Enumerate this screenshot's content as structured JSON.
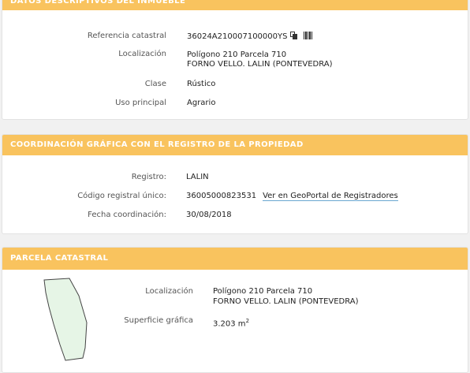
{
  "section1": {
    "title": "DATOS DESCRIPTIVOS DEL INMUEBLE",
    "fields": {
      "referencia_label": "Referencia catastral",
      "referencia_value": "36024A210007100000YS",
      "localizacion_label": "Localización",
      "localizacion_line1": "Polígono 210 Parcela 710",
      "localizacion_line2": "FORNO VELLO. LALIN (PONTEVEDRA)",
      "clase_label": "Clase",
      "clase_value": "Rústico",
      "uso_label": "Uso principal",
      "uso_value": "Agrario"
    },
    "icons": [
      "copy-icon",
      "barcode-icon"
    ]
  },
  "section2": {
    "title": "COORDINACIÓN GRÁFICA CON EL REGISTRO DE LA PROPIEDAD",
    "fields": {
      "registro_label": "Registro:",
      "registro_value": "LALIN",
      "codigo_label": "Código registral único:",
      "codigo_value": "36005000823531",
      "codigo_link": "Ver en GeoPortal de Registradores",
      "fecha_label": "Fecha coordinación:",
      "fecha_value": "30/08/2018"
    }
  },
  "section3": {
    "title": "PARCELA CATASTRAL",
    "fields": {
      "localizacion_label": "Localización",
      "localizacion_line1": "Polígono 210 Parcela 710",
      "localizacion_line2": "FORNO VELLO. LALIN (PONTEVEDRA)",
      "superficie_label": "Superficie gráfica",
      "superficie_value": "3.203 m",
      "superficie_unit_exp": "2"
    },
    "parcel_fill": "#e6f5e6",
    "parcel_stroke": "#444444"
  },
  "colors": {
    "header": "#f9c35e",
    "background": "#f1f1f1",
    "link_underline": "#6aa6d0"
  }
}
